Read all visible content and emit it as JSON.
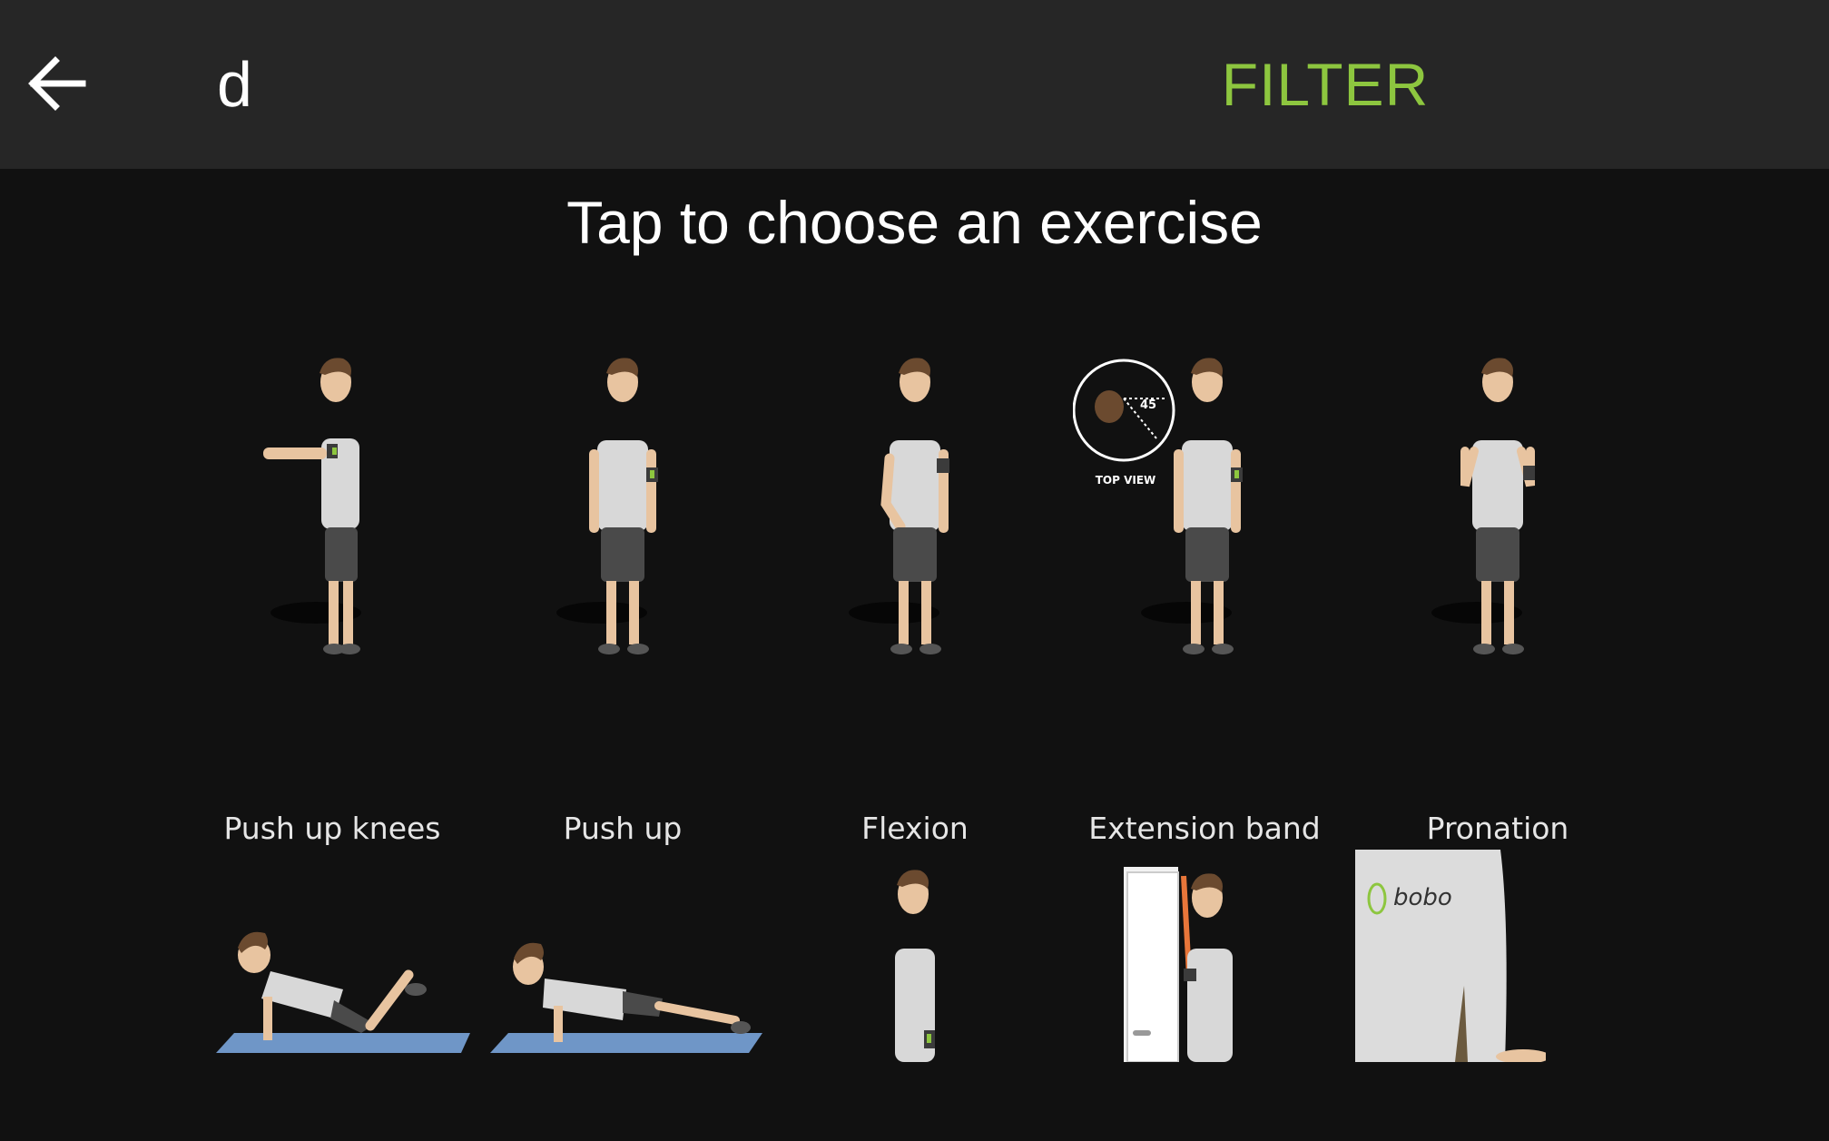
{
  "toolbar": {
    "back_icon": "arrow-left-icon",
    "search_value": "d",
    "filter_label": "FILTER",
    "accent_color": "#8dc63f"
  },
  "page": {
    "title": "Tap to choose an exercise"
  },
  "exercises_row1": [
    {
      "label": "Push up knees"
    },
    {
      "label": "Push up"
    },
    {
      "label": "Flexion"
    },
    {
      "label": "Extension band",
      "inset_text": "TOP VIEW",
      "inset_angle": "45"
    },
    {
      "label": "Pronation"
    }
  ],
  "exercises_row2": [
    {
      "illustration": "push-up-knees-on-mat"
    },
    {
      "illustration": "push-up-on-mat"
    },
    {
      "illustration": "side-standing-man"
    },
    {
      "illustration": "man-at-door-with-band"
    },
    {
      "illustration": "shirt-closeup",
      "brand_text": "bobo"
    }
  ]
}
